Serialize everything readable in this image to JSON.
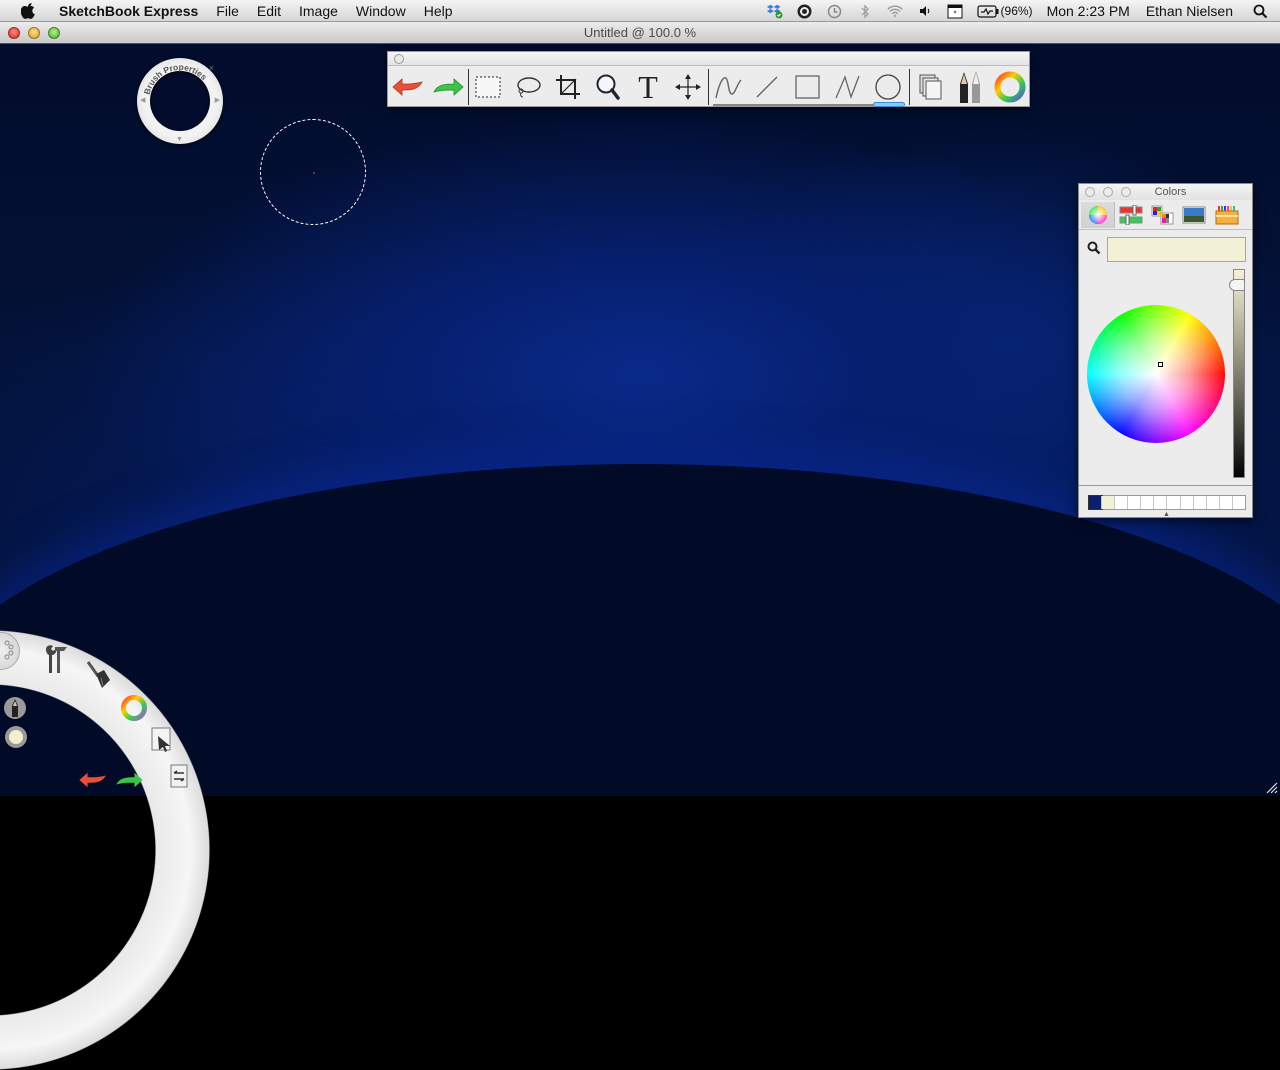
{
  "menubar": {
    "app_name": "SketchBook Express",
    "menus": [
      "File",
      "Edit",
      "Image",
      "Window",
      "Help"
    ],
    "status": {
      "battery": "(96%)",
      "clock": "Mon 2:23 PM",
      "user": "Ethan Nielsen"
    },
    "status_icons": [
      "dropbox-icon",
      "growl-icon",
      "time-machine-icon",
      "bluetooth-icon",
      "wifi-icon",
      "volume-icon",
      "input-menu-icon",
      "battery-icon",
      "spotlight-icon"
    ]
  },
  "window": {
    "title": "Untitled @ 100.0 %"
  },
  "brush_puck": {
    "label": "Brush Properties"
  },
  "toolbar": {
    "tools": [
      {
        "name": "undo",
        "label": "Undo"
      },
      {
        "name": "redo",
        "label": "Redo"
      },
      {
        "name": "select-rect",
        "label": "Rectangle Select"
      },
      {
        "name": "lasso",
        "label": "Lasso"
      },
      {
        "name": "crop",
        "label": "Crop"
      },
      {
        "name": "zoom",
        "label": "Zoom"
      },
      {
        "name": "text",
        "label": "T"
      },
      {
        "name": "move",
        "label": "Move"
      },
      {
        "name": "freehand-line",
        "label": "Freehand"
      },
      {
        "name": "straight-line",
        "label": "Line"
      },
      {
        "name": "rectangle",
        "label": "Rectangle"
      },
      {
        "name": "polyline",
        "label": "Polyline"
      },
      {
        "name": "ellipse",
        "label": "Ellipse"
      },
      {
        "name": "layers",
        "label": "Layers"
      },
      {
        "name": "brushes",
        "label": "Brushes"
      },
      {
        "name": "color-wheel",
        "label": "Color"
      }
    ],
    "active_shape_tool": "ellipse"
  },
  "colors_panel": {
    "title": "Colors",
    "modes": [
      "Color Wheel",
      "Color Sliders",
      "Color Palettes",
      "Image Palettes",
      "Crayons"
    ],
    "selected_mode": "Color Wheel",
    "search_value": "",
    "brightness_value": 0.95,
    "swatches": [
      "#0a1f6e",
      "#f2f1d8",
      "#ffffff",
      "#ffffff",
      "#ffffff",
      "#ffffff",
      "#ffffff",
      "#ffffff",
      "#ffffff",
      "#ffffff",
      "#ffffff",
      "#ffffff"
    ],
    "current_color": "#f2f1d8"
  },
  "lagoon": {
    "items": [
      "Tools",
      "Brushes",
      "Color Editor",
      "Select",
      "Layers"
    ],
    "current_brush_color": "#f2efcf"
  }
}
